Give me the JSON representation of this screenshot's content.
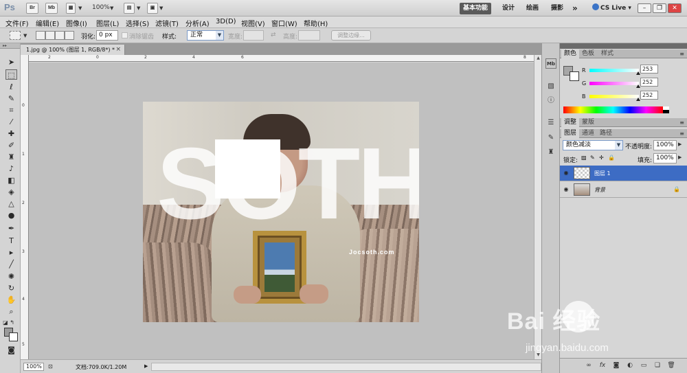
{
  "app": {
    "logo": "Ps",
    "bridge_label": "Br",
    "minibridge_label": "Mb",
    "zoom": "100%",
    "workspaces": [
      "基本功能",
      "设计",
      "绘画",
      "摄影"
    ],
    "more_label": "»",
    "cslive_label": "CS Live",
    "win_min": "–",
    "win_restore": "❐",
    "win_close": "✕"
  },
  "menu": {
    "items": [
      "文件(F)",
      "编辑(E)",
      "图像(I)",
      "图层(L)",
      "选择(S)",
      "滤镜(T)",
      "分析(A)",
      "3D(D)",
      "视图(V)",
      "窗口(W)",
      "帮助(H)"
    ]
  },
  "options": {
    "feather_label": "羽化:",
    "feather_value": "0 px",
    "antialias_label": "消除锯齿",
    "style_label": "样式:",
    "style_value": "正常",
    "width_label": "宽度:",
    "height_label": "高度:",
    "refine_edge_label": "调整边缘..."
  },
  "document": {
    "tab_title": "1.jpg @ 100% (图层 1, RGB/8*) *",
    "tab_close": "×",
    "overlay_text": "SOTH",
    "site_text": "Jocsoth.com",
    "ruler_top_labels": [
      "2",
      "0",
      "2",
      "4",
      "6",
      "8"
    ],
    "ruler_left_labels": [
      "0",
      "1",
      "2",
      "3",
      "4",
      "5"
    ]
  },
  "status": {
    "zoom": "100%",
    "doc_info": "文档:709.0K/1.20M"
  },
  "color_panel": {
    "tabs": [
      "颜色",
      "色板",
      "样式"
    ],
    "channels": [
      {
        "name": "R",
        "value": "253"
      },
      {
        "name": "G",
        "value": "252"
      },
      {
        "name": "B",
        "value": "252"
      }
    ]
  },
  "adjust_panel": {
    "tabs": [
      "调整",
      "蒙版"
    ]
  },
  "layers_panel": {
    "tabs": [
      "图层",
      "通道",
      "路径"
    ],
    "blend_mode": "颜色减淡",
    "opacity_label": "不透明度:",
    "opacity_value": "100%",
    "lock_label": "锁定:",
    "fill_label": "填充:",
    "fill_value": "100%",
    "layers": [
      {
        "name": "图层 1",
        "selected": true
      },
      {
        "name": "背景",
        "selected": false
      }
    ]
  },
  "watermark": {
    "logo_text": "Bai  经验",
    "url": "jingyan.baidu.com"
  }
}
